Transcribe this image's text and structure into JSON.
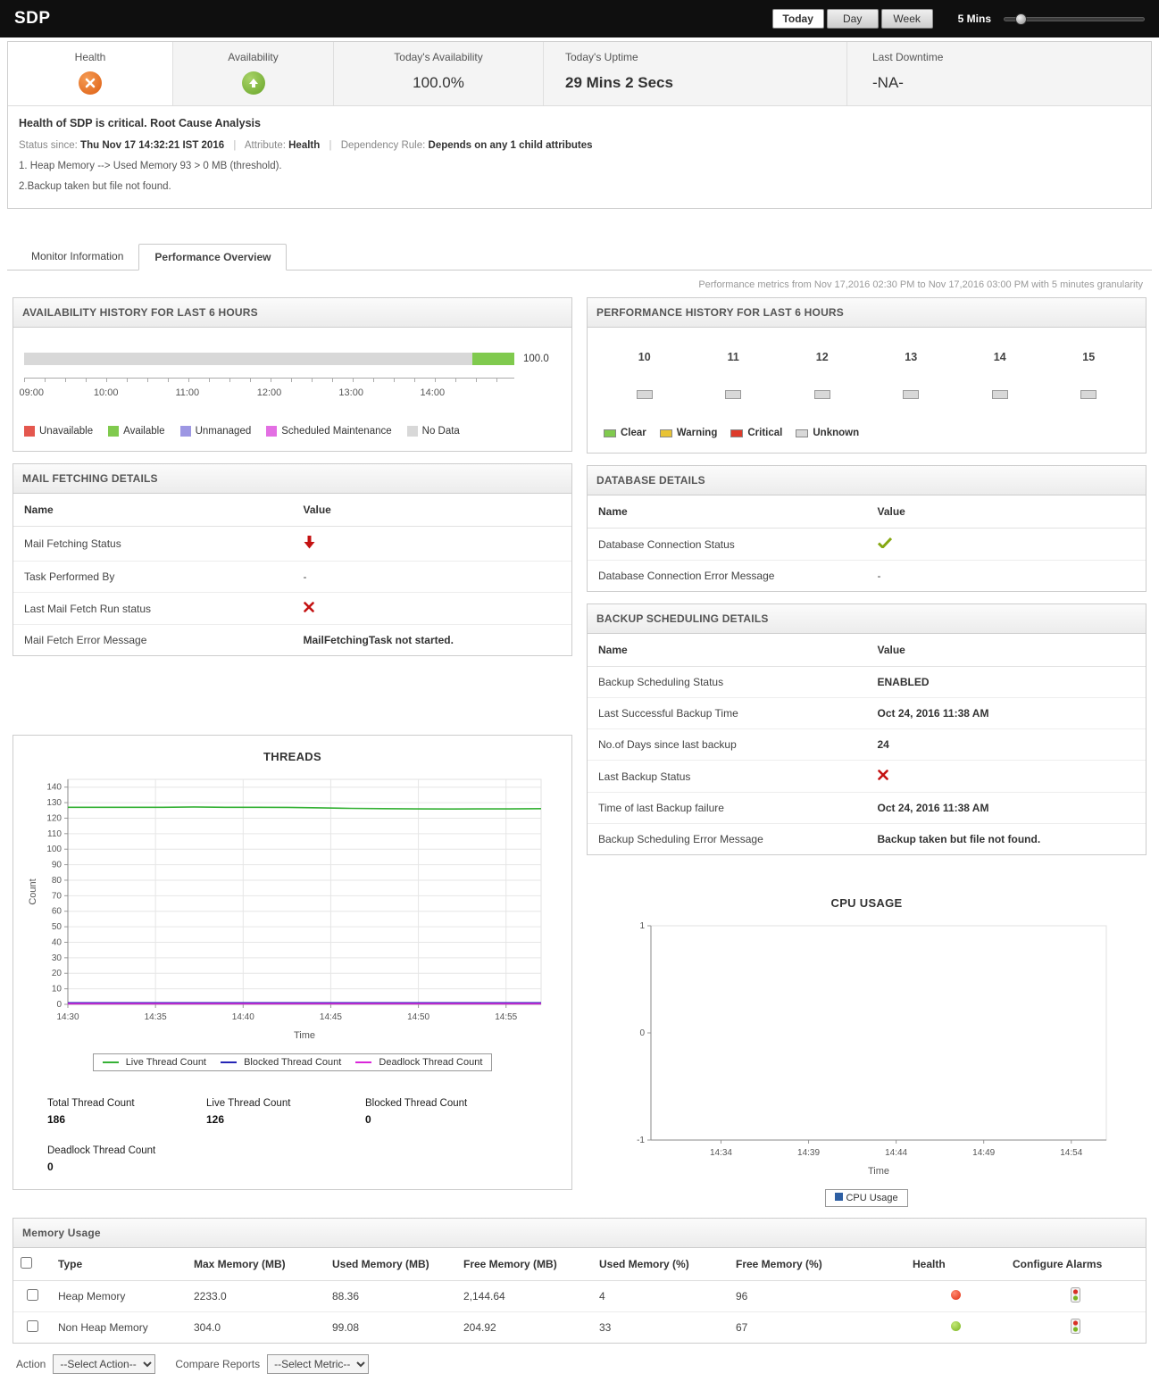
{
  "topbar": {
    "title": "SDP",
    "periods": {
      "today": "Today",
      "day": "Day",
      "week": "Week"
    },
    "granularity": "5 Mins"
  },
  "summary": {
    "health_label": "Health",
    "availability_label": "Availability",
    "todays_availability_label": "Today's Availability",
    "todays_availability_value": "100.0%",
    "todays_uptime_label": "Today's Uptime",
    "todays_uptime_value": "29 Mins 2 Secs",
    "last_downtime_label": "Last Downtime",
    "last_downtime_value": "-NA-"
  },
  "rca": {
    "heading": "Health of SDP is critical.",
    "link": "Root Cause Analysis",
    "status_since_label": "Status since:",
    "status_since_value": "Thu Nov 17 14:32:21 IST 2016",
    "attribute_label": "Attribute:",
    "attribute_value": "Health",
    "dependency_label": "Dependency Rule:",
    "dependency_value": "Depends on any 1 child attributes",
    "reason1": "1. Heap Memory --> Used Memory 93 > 0 MB (threshold).",
    "reason2": "2.Backup taken but file not found."
  },
  "tabs": {
    "monitor_info": "Monitor Information",
    "perf_overview": "Performance Overview"
  },
  "metrics_note": "Performance metrics from Nov 17,2016 02:30 PM to Nov 17,2016 03:00 PM with 5 minutes granularity",
  "availability_history": {
    "title": "AVAILABILITY HISTORY FOR LAST 6 HOURS",
    "value_label": "100.0",
    "ticks": [
      "09:00",
      "10:00",
      "11:00",
      "12:00",
      "13:00",
      "14:00"
    ],
    "segments": [
      {
        "status": "No Data",
        "percent": 91.5,
        "color": "#d8d8d8"
      },
      {
        "status": "Available",
        "percent": 8.5,
        "color": "#80ca4e"
      }
    ],
    "legend": [
      {
        "label": "Unavailable",
        "color": "#e4574e"
      },
      {
        "label": "Available",
        "color": "#80ca4e"
      },
      {
        "label": "Unmanaged",
        "color": "#9d97e3"
      },
      {
        "label": "Scheduled Maintenance",
        "color": "#e36fe3"
      },
      {
        "label": "No Data",
        "color": "#d8d8d8"
      }
    ]
  },
  "performance_history": {
    "title": "PERFORMANCE HISTORY FOR LAST 6 HOURS",
    "hours": [
      "10",
      "11",
      "12",
      "13",
      "14",
      "15"
    ],
    "hour_status": "Unknown",
    "legend": [
      {
        "label": "Clear",
        "color": "#80ca4e"
      },
      {
        "label": "Warning",
        "color": "#e8c335"
      },
      {
        "label": "Critical",
        "color": "#dd3b2b"
      },
      {
        "label": "Unknown",
        "color": "#d8d8d8"
      }
    ]
  },
  "mail_fetching": {
    "title": "MAIL FETCHING DETAILS",
    "name_header": "Name",
    "value_header": "Value",
    "rows": [
      {
        "name": "Mail Fetching Status",
        "value_icon": "red-down-arrow"
      },
      {
        "name": "Task Performed By",
        "value": "-"
      },
      {
        "name": "Last Mail Fetch Run status",
        "value_icon": "red-cross"
      },
      {
        "name": "Mail Fetch Error Message",
        "value": "MailFetchingTask not started."
      }
    ]
  },
  "database_details": {
    "title": "DATABASE DETAILS",
    "name_header": "Name",
    "value_header": "Value",
    "rows": [
      {
        "name": "Database Connection Status",
        "value_icon": "green-check"
      },
      {
        "name": "Database Connection Error Message",
        "value": "-"
      }
    ]
  },
  "backup_details": {
    "title": "BACKUP SCHEDULING DETAILS",
    "name_header": "Name",
    "value_header": "Value",
    "rows": [
      {
        "name": "Backup Scheduling Status",
        "value": "ENABLED"
      },
      {
        "name": "Last Successful Backup Time",
        "value": "Oct 24, 2016 11:38 AM"
      },
      {
        "name": "No.of Days since last backup",
        "value": "24"
      },
      {
        "name": "Last Backup Status",
        "value_icon": "red-cross"
      },
      {
        "name": "Time of last Backup failure",
        "value": "Oct 24, 2016 11:38 AM"
      },
      {
        "name": "Backup Scheduling Error Message",
        "value": "Backup taken but file not found."
      }
    ]
  },
  "threads_summary": {
    "total_label": "Total Thread Count",
    "total_value": "186",
    "live_label": "Live Thread Count",
    "live_value": "126",
    "blocked_label": "Blocked Thread Count",
    "blocked_value": "0",
    "deadlock_label": "Deadlock Thread Count",
    "deadlock_value": "0"
  },
  "memory_usage": {
    "title": "Memory Usage",
    "columns": [
      "Type",
      "Max Memory (MB)",
      "Used Memory (MB)",
      "Free Memory (MB)",
      "Used Memory (%)",
      "Free Memory (%)",
      "Health",
      "Configure Alarms"
    ],
    "rows": [
      {
        "type": "Heap Memory",
        "max_mb": "2233.0",
        "used_mb": "88.36",
        "free_mb": "2,144.64",
        "used_pct": "4",
        "free_pct": "96",
        "health": "critical"
      },
      {
        "type": "Non Heap Memory",
        "max_mb": "304.0",
        "used_mb": "99.08",
        "free_mb": "204.92",
        "used_pct": "33",
        "free_pct": "67",
        "health": "clear"
      }
    ],
    "action_label": "Action",
    "action_value": "--Select Action--",
    "compare_label": "Compare Reports",
    "compare_value": "--Select Metric--"
  },
  "chart_data": [
    {
      "id": "threads-chart",
      "type": "line",
      "title": "THREADS",
      "xlabel": "Time",
      "ylabel": "Count",
      "ylim": [
        0,
        145
      ],
      "ytick_step": 10,
      "ytick_max": 140,
      "x_min": 0,
      "x_max": 27,
      "grid": true,
      "xticks": [
        {
          "pos": 0,
          "label": "14:30"
        },
        {
          "pos": 5,
          "label": "14:35"
        },
        {
          "pos": 10,
          "label": "14:40"
        },
        {
          "pos": 15,
          "label": "14:45"
        },
        {
          "pos": 20,
          "label": "14:50"
        },
        {
          "pos": 25,
          "label": "14:55"
        }
      ],
      "series": [
        {
          "name": "Live Thread Count",
          "color": "#35b135",
          "values": [
            127,
            127,
            127,
            127,
            127.2,
            127,
            127,
            126.9,
            126.6,
            126.3,
            126.1,
            126,
            125.9,
            126,
            126,
            126.1
          ]
        },
        {
          "name": "Blocked Thread Count",
          "color": "#2525b5",
          "values": [
            1,
            1,
            1,
            1,
            1,
            1,
            1,
            1,
            1,
            1,
            1,
            1,
            1,
            1,
            1,
            1
          ]
        },
        {
          "name": "Deadlock Thread Count",
          "color": "#d926d9",
          "values": [
            0.4,
            0.4,
            0.4,
            0.4,
            0.4,
            0.4,
            0.4,
            0.4,
            0.4,
            0.4,
            0.4,
            0.4,
            0.4,
            0.4,
            0.4,
            0.4
          ]
        }
      ]
    },
    {
      "id": "cpu-chart",
      "type": "line",
      "title": "CPU USAGE",
      "xlabel": "Time",
      "ylabel": "",
      "ylim": [
        -1,
        1
      ],
      "yticks": [
        -1,
        0,
        1
      ],
      "x_min": 0,
      "x_max": 26,
      "grid": false,
      "xticks": [
        {
          "pos": 4,
          "label": "14:34"
        },
        {
          "pos": 9,
          "label": "14:39"
        },
        {
          "pos": 14,
          "label": "14:44"
        },
        {
          "pos": 19,
          "label": "14:49"
        },
        {
          "pos": 24,
          "label": "14:54"
        }
      ],
      "series": [],
      "legend_label": "CPU Usage",
      "legend_color": "#2e5fa3"
    }
  ]
}
